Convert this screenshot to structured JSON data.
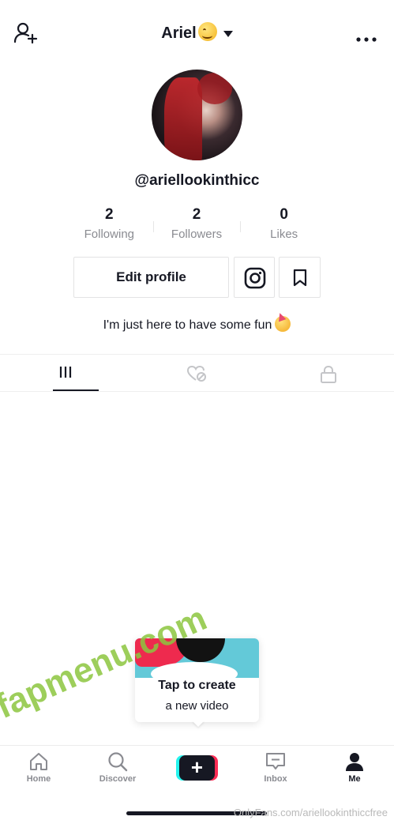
{
  "header": {
    "title": "Ariel",
    "title_emoji_icon": "smiling-face-emoji",
    "add_user_icon": "add-user-icon",
    "more_icon": "more-dots-icon"
  },
  "profile": {
    "username": "@ariellookinthicc",
    "stats": [
      {
        "value": "2",
        "label": "Following"
      },
      {
        "value": "2",
        "label": "Followers"
      },
      {
        "value": "0",
        "label": "Likes"
      }
    ],
    "edit_label": "Edit profile",
    "bio": "I'm just here to have some fun",
    "bio_emoji_icon": "partying-face-emoji"
  },
  "tabs": [
    {
      "icon": "grid-icon",
      "active": true
    },
    {
      "icon": "liked-heart-icon",
      "active": false
    },
    {
      "icon": "lock-icon",
      "active": false
    }
  ],
  "tooltip": {
    "title": "Tap to create",
    "subtitle": "a new video"
  },
  "watermark": "fapmenu.com",
  "source_watermark": "OnlyFans.com/ariellookinthiccfree",
  "nav": {
    "home": "Home",
    "discover": "Discover",
    "inbox": "Inbox",
    "me": "Me"
  },
  "colors": {
    "text": "#161823",
    "muted": "#8a8b91",
    "accent_cyan": "#25f4ee",
    "accent_red": "#fe2c55",
    "watermark_green": "#8cc63f"
  }
}
